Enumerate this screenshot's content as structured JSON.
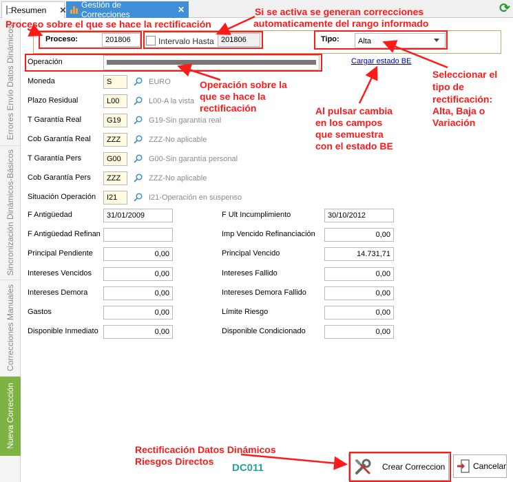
{
  "tabs": [
    {
      "label": "Resumen",
      "icon": "document-icon",
      "active": false
    },
    {
      "label": "Gestión de Correcciones",
      "icon": "chart-bars-icon",
      "active": true
    }
  ],
  "side_tabs": [
    {
      "label": "Errores Envío Datos Dinámicos",
      "selected": false
    },
    {
      "label": "Sincronización Dinámicos-Básicos",
      "selected": false
    },
    {
      "label": "Correcciones Manuales",
      "selected": false
    },
    {
      "label": "Nueva Corrección",
      "selected": true
    }
  ],
  "header": {
    "proceso_label": "Proceso:",
    "proceso_value": "201806",
    "intervalo_label": "Intervalo Hasta",
    "intervalo_value": "201806",
    "intervalo_checked": false,
    "tipo_label": "Tipo:",
    "tipo_value": "Alta"
  },
  "operacion": {
    "label": "Operación",
    "link": "Cargar estado BE"
  },
  "lookups": [
    {
      "label": "Moneda",
      "code": "S",
      "desc": "EURO"
    },
    {
      "label": "Plazo Residual",
      "code": "L00",
      "desc": "L00-A la vista"
    },
    {
      "label": "T Garantía Real",
      "code": "G19",
      "desc": "G19-Sin garantía real"
    },
    {
      "label": "Cob Garantía Real",
      "code": "ZZZ",
      "desc": "ZZZ-No aplicable"
    },
    {
      "label": "T Garantía Pers",
      "code": "G00",
      "desc": "G00-Sin garantía personal"
    },
    {
      "label": "Cob Garantía Pers",
      "code": "ZZZ",
      "desc": "ZZZ-No aplicable"
    },
    {
      "label": "Situación Operación",
      "code": "I21",
      "desc": "I21-Operación en suspenso"
    }
  ],
  "left_fields": [
    {
      "label": "F Antigüedad",
      "value": "31/01/2009",
      "align": "left"
    },
    {
      "label": "F Antigüedad Refinan",
      "value": "",
      "align": "left"
    },
    {
      "label": "Principal Pendiente",
      "value": "0,00",
      "align": "right"
    },
    {
      "label": "Intereses Vencidos",
      "value": "0,00",
      "align": "right"
    },
    {
      "label": "Intereses Demora",
      "value": "0,00",
      "align": "right"
    },
    {
      "label": "Gastos",
      "value": "0,00",
      "align": "right"
    },
    {
      "label": "Disponible Inmediato",
      "value": "0,00",
      "align": "right"
    }
  ],
  "right_fields": [
    {
      "label": "F Ult Incumplimiento",
      "value": "30/10/2012",
      "align": "left"
    },
    {
      "label": "Imp Vencido Refinanciación",
      "value": "0,00",
      "align": "right"
    },
    {
      "label": "Principal Vencido",
      "value": "14.731,71",
      "align": "right"
    },
    {
      "label": "Intereses Fallido",
      "value": "0,00",
      "align": "right"
    },
    {
      "label": "Intereses Demora Fallido",
      "value": "0,00",
      "align": "right"
    },
    {
      "label": "Límite Riesgo",
      "value": "0,00",
      "align": "right"
    },
    {
      "label": "Disponible Condicionado",
      "value": "0,00",
      "align": "right"
    }
  ],
  "buttons": {
    "crear": "Crear Correccion",
    "cancelar": "Cancelar"
  },
  "annotations": {
    "proceso": "Proceso sobre el que se hace la rectificación",
    "intervalo": [
      "Si se activa se generan correcciones",
      "automaticamente del rango informado"
    ],
    "operacion": [
      "Operación sobre la",
      "que se hace la",
      "rectificación"
    ],
    "cargar": [
      "Al pulsar cambia",
      "en los campos",
      "que semuestra",
      "con el estado BE"
    ],
    "tipo": [
      "Seleccionar el",
      "tipo de",
      "rectificación:",
      "Alta, Baja o",
      "Variación"
    ],
    "bottom": [
      "Rectificación Datos Dinámicos",
      "Riesgos Directos"
    ],
    "code": "DC011"
  },
  "colors": {
    "annotation_red": "#ff1a1a",
    "selected_side_tab": "#7cb342",
    "active_tab": "#3e8fd8",
    "code_teal": "#2aa198"
  }
}
